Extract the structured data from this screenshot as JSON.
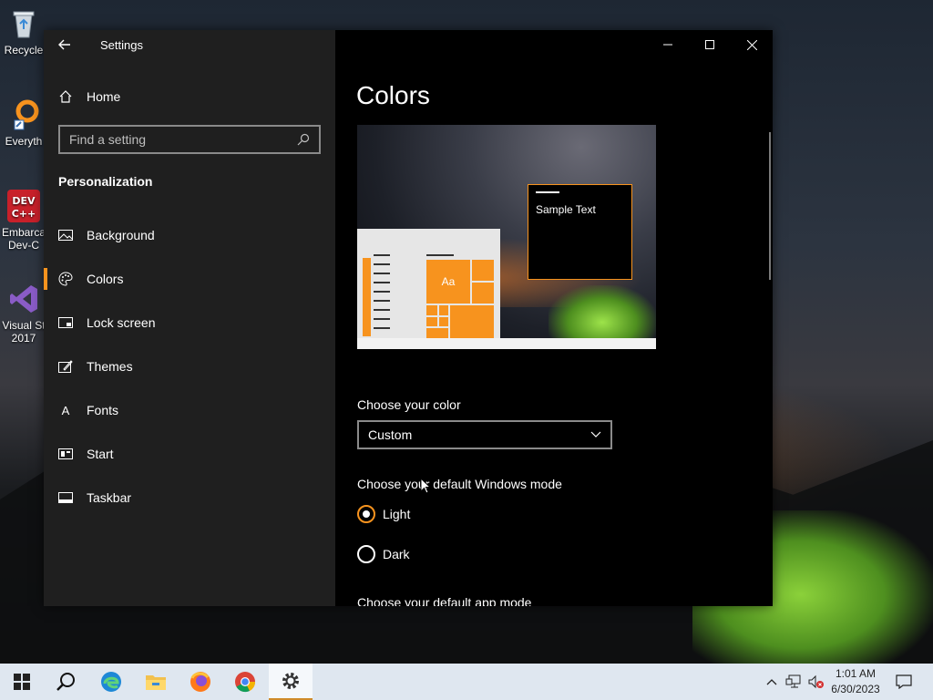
{
  "desktop": {
    "icons": [
      {
        "label": "Recycle",
        "icon": "recycle-bin-icon"
      },
      {
        "label": "Everyth",
        "icon": "everything-search-icon"
      },
      {
        "label": "Embarca",
        "label2": "Dev-C",
        "icon": "devcpp-icon"
      },
      {
        "label": "Visual St",
        "label2": "2017",
        "icon": "visual-studio-icon"
      }
    ]
  },
  "window": {
    "app_title": "Settings",
    "back_icon": "back-arrow-icon",
    "controls": {
      "minimize": "—",
      "maximize": "☐",
      "close": "✕"
    }
  },
  "sidebar": {
    "home_label": "Home",
    "search_placeholder": "Find a setting",
    "section_title": "Personalization",
    "items": [
      {
        "label": "Background",
        "icon": "picture-icon"
      },
      {
        "label": "Colors",
        "icon": "palette-icon",
        "active": true
      },
      {
        "label": "Lock screen",
        "icon": "lock-screen-icon"
      },
      {
        "label": "Themes",
        "icon": "themes-icon"
      },
      {
        "label": "Fonts",
        "icon": "fonts-icon",
        "glyph": "A"
      },
      {
        "label": "Start",
        "icon": "start-icon"
      },
      {
        "label": "Taskbar",
        "icon": "taskbar-icon"
      }
    ]
  },
  "main": {
    "page_title": "Colors",
    "preview": {
      "tile_text": "Aa",
      "sample_text": "Sample Text"
    },
    "choose_color_label": "Choose your color",
    "choose_color_value": "Custom",
    "windows_mode_label": "Choose your default Windows mode",
    "windows_mode_options": [
      {
        "label": "Light",
        "selected": true
      },
      {
        "label": "Dark",
        "selected": false
      }
    ],
    "app_mode_label": "Choose your default app mode"
  },
  "taskbar": {
    "apps": [
      "start-icon",
      "search-icon",
      "edge-icon",
      "file-explorer-icon",
      "firefox-icon",
      "chrome-icon",
      "settings-icon"
    ],
    "active_app": "settings-icon",
    "tray": [
      "chevron-up-icon",
      "network-icon",
      "volume-muted-icon"
    ],
    "time": "1:01 AM",
    "date": "6/30/2023",
    "notification_icon": "notification-icon"
  },
  "colors": {
    "accent": "#f7931e",
    "sidebar_bg": "#1f1f1f",
    "main_bg": "#000000",
    "taskbar_bg": "#dfe7f0"
  }
}
